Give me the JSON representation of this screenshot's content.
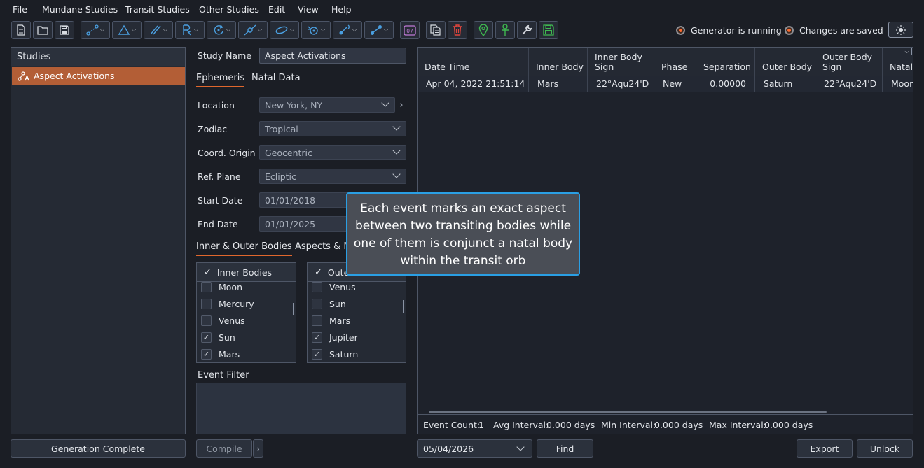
{
  "menu": [
    "File",
    "Mundane Studies",
    "Transit Studies",
    "Other Studies",
    "Edit",
    "View",
    "Help"
  ],
  "toolbar": {
    "icons": [
      "new-file-icon",
      "open-folder-icon",
      "save-icon",
      "aspect-line-icon",
      "triangle-icon",
      "parallel-icon",
      "retrograde-icon",
      "cycle-icon",
      "node-icon",
      "ellipse-icon",
      "target-icon",
      "moon-icon",
      "connect-icon",
      "calendar-icon",
      "copy-icon",
      "delete-icon",
      "map-pin-icon",
      "ankh-icon",
      "wrench-icon",
      "save-green-icon"
    ],
    "calendar_label": "07"
  },
  "status": {
    "generator": "Generator is running",
    "changes": "Changes are saved"
  },
  "studies": {
    "header": "Studies",
    "items": [
      {
        "label": "Aspect Activations"
      }
    ],
    "status_button": "Generation Complete"
  },
  "form": {
    "study_name_label": "Study Name",
    "study_name_value": "Aspect Activations",
    "tabs": [
      "Ephemeris",
      "Natal Data"
    ],
    "location_label": "Location",
    "location_value": "New York, NY",
    "zodiac_label": "Zodiac",
    "zodiac_value": "Tropical",
    "coord_label": "Coord. Origin",
    "coord_value": "Geocentric",
    "refplane_label": "Ref. Plane",
    "refplane_value": "Ecliptic",
    "start_label": "Start Date",
    "start_value": "01/01/2018",
    "end_label": "End Date",
    "end_value": "01/01/2025",
    "body_tabs": [
      "Inner & Outer Bodies",
      "Aspects & N"
    ],
    "inner_header": "Inner Bodies",
    "outer_header": "Oute",
    "inner_bodies": [
      {
        "name": "Moon",
        "checked": false
      },
      {
        "name": "Mercury",
        "checked": false
      },
      {
        "name": "Venus",
        "checked": false
      },
      {
        "name": "Sun",
        "checked": true
      },
      {
        "name": "Mars",
        "checked": true
      }
    ],
    "outer_bodies": [
      {
        "name": "Venus",
        "checked": false
      },
      {
        "name": "Sun",
        "checked": false
      },
      {
        "name": "Mars",
        "checked": false
      },
      {
        "name": "Jupiter",
        "checked": true
      },
      {
        "name": "Saturn",
        "checked": true
      }
    ],
    "event_filter_label": "Event Filter",
    "compile_button": "Compile"
  },
  "table": {
    "columns": [
      "Date Time",
      "Inner Body",
      "Inner Body Sign",
      "Phase",
      "Separation",
      "Outer Body",
      "Outer Body Sign",
      "Natal"
    ],
    "rows": [
      [
        "Apr 04, 2022 21:51:14",
        "Mars",
        "22°Aqu24'D",
        "New",
        "0.00000",
        "Saturn",
        "22°Aqu24'D",
        "Moon"
      ]
    ]
  },
  "summary": {
    "event_count_label": "Event Count:",
    "event_count": "1",
    "avg_label": "Avg Interval:",
    "avg_value": "0.000 days",
    "min_label": "Min Interval:",
    "min_value": "0.000 days",
    "max_label": "Max Interval:",
    "max_value": "0.000 days"
  },
  "bottom": {
    "date_value": "05/04/2026",
    "find_button": "Find",
    "export_button": "Export",
    "unlock_button": "Unlock"
  },
  "tooltip": "Each event marks an exact aspect between two transiting bodies while one of them is conjunct a natal body within the transit orb",
  "colors": {
    "accent": "#e0672d",
    "selection": "#b35e36",
    "tooltip_border": "#2a9fe4",
    "icon_blue": "#4a9fe0",
    "icon_green": "#3fb950",
    "icon_red": "#e0453d"
  }
}
